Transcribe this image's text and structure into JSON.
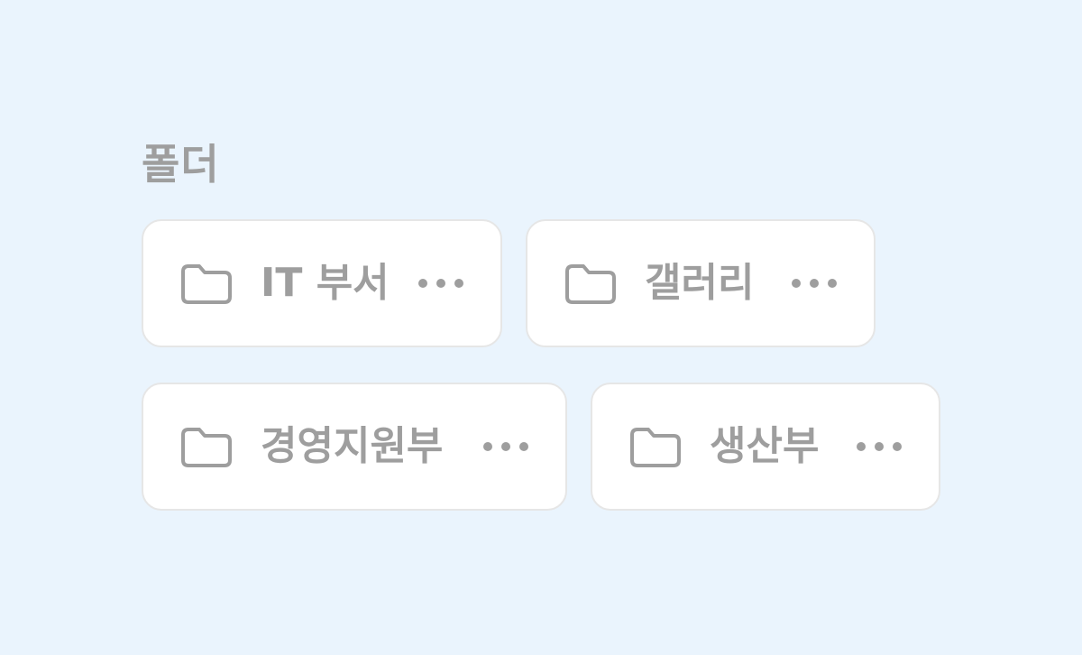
{
  "section": {
    "title": "폴더"
  },
  "folders": [
    {
      "name": "IT 부서",
      "icon": "folder-icon",
      "menu_icon": "more-horizontal-icon"
    },
    {
      "name": "갤러리",
      "icon": "folder-icon",
      "menu_icon": "more-horizontal-icon"
    },
    {
      "name": "경영지원부",
      "icon": "folder-icon",
      "menu_icon": "more-horizontal-icon"
    },
    {
      "name": "생산부",
      "icon": "folder-icon",
      "menu_icon": "more-horizontal-icon"
    }
  ],
  "colors": {
    "background": "#eaf4fd",
    "card_background": "#ffffff",
    "card_border": "#e6e6e6",
    "text": "#9e9e9e"
  }
}
